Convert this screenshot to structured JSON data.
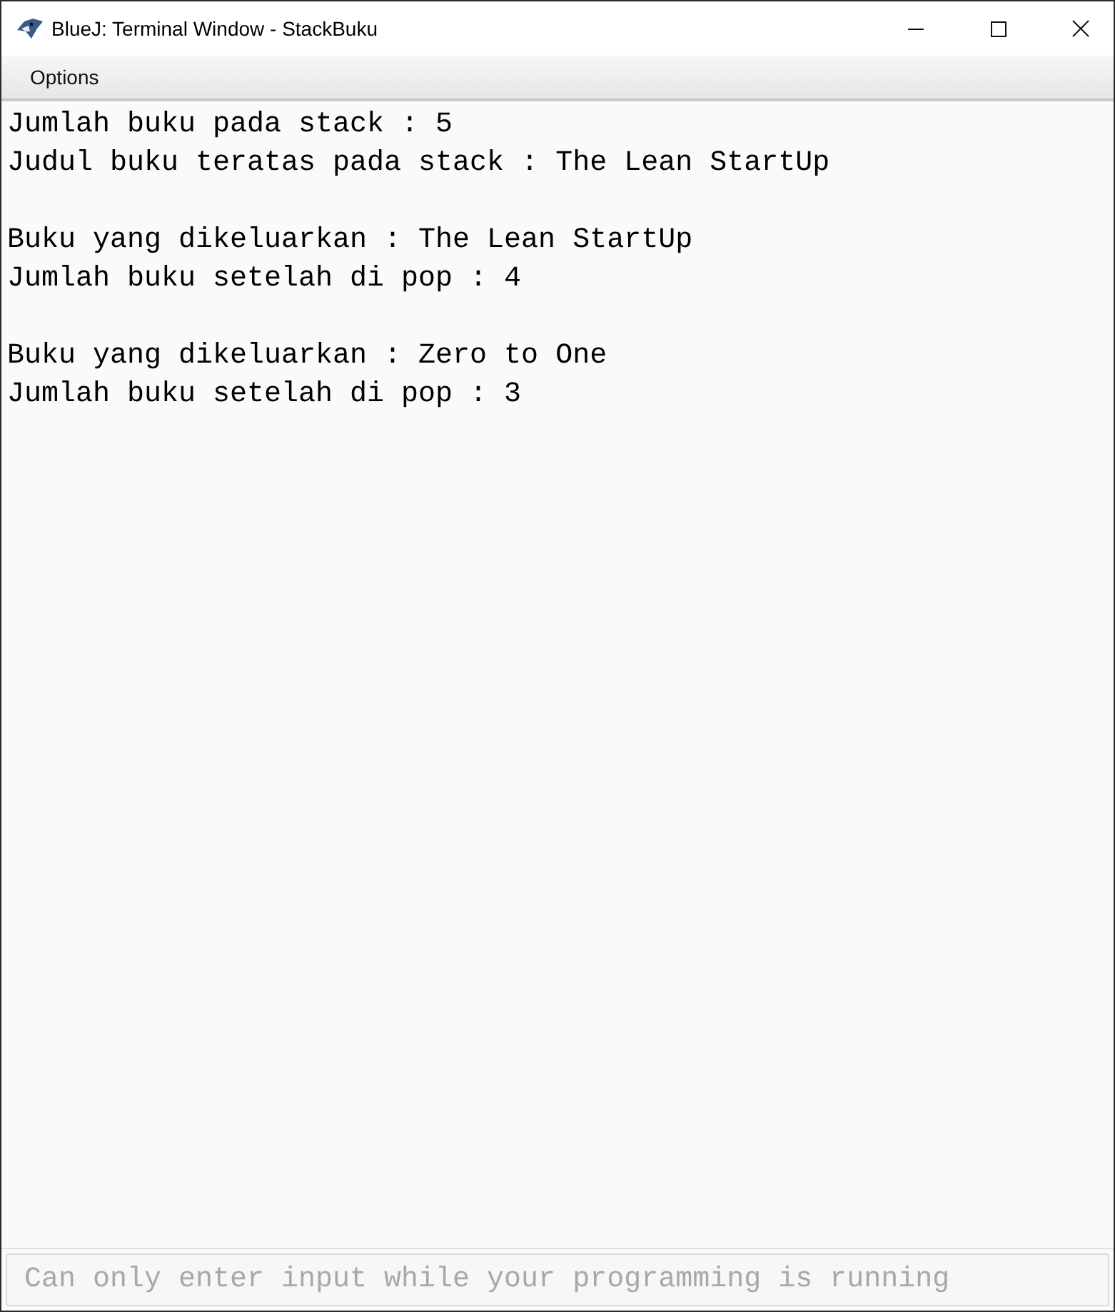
{
  "window": {
    "title": "BlueJ: Terminal Window - StackBuku"
  },
  "menu": [
    "Options"
  ],
  "output_blocks": [
    [
      "Jumlah buku pada stack : 5",
      "Judul buku teratas pada stack : The Lean StartUp"
    ],
    [
      "Buku yang dikeluarkan : The Lean StartUp",
      "Jumlah buku setelah di pop : 4"
    ],
    [
      "Buku yang dikeluarkan : Zero to One",
      "Jumlah buku setelah di pop : 3"
    ]
  ],
  "input": {
    "placeholder": "Can only enter input while your programming is running"
  }
}
